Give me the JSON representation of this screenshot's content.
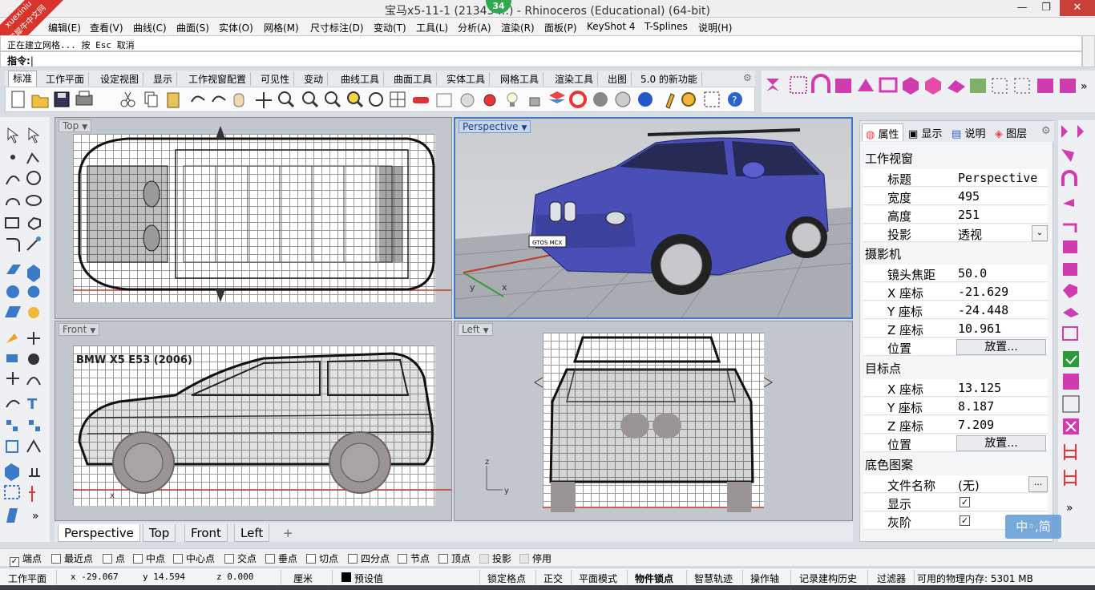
{
  "window": {
    "title": "宝马x5-11-1 (21343 …) - Rhinoceros (Educational) (64-bit)",
    "badge": "34",
    "minimize": "—",
    "maximize": "❐",
    "close": "✕"
  },
  "watermark": {
    "line1": "xuexiniu",
    "line2": "学犀牛中文网"
  },
  "menu": [
    "编辑(E)",
    "查看(V)",
    "曲线(C)",
    "曲面(S)",
    "实体(O)",
    "网格(M)",
    "尺寸标注(D)",
    "变动(T)",
    "工具(L)",
    "分析(A)",
    "渲染(R)",
    "面板(P)",
    "KeyShot 4",
    "T-Splines",
    "说明(H)"
  ],
  "command": {
    "history": "正在建立网格... 按 Esc 取消",
    "prompt": "指令:"
  },
  "toolbar_tabs": [
    "标准",
    "工作平面",
    "设定视图",
    "显示",
    "工作视窗配置",
    "可见性",
    "变动",
    "曲线工具",
    "曲面工具",
    "实体工具",
    "网格工具",
    "渲染工具",
    "出图",
    "5.0 的新功能"
  ],
  "active_toolbar_tab": "标准",
  "viewports": {
    "top": {
      "label": "Top"
    },
    "perspective": {
      "label": "Perspective",
      "plate": "GTOS MCX"
    },
    "front": {
      "label": "Front",
      "caption": "BMW X5 E53 (2006)"
    },
    "left": {
      "label": "Left"
    }
  },
  "viewport_tabs": [
    "Perspective",
    "Top",
    "Front",
    "Left"
  ],
  "viewport_tab_add": "+",
  "panel": {
    "tabs": [
      "属性",
      "显示",
      "说明",
      "图层"
    ],
    "sections": {
      "viewport": "工作视窗",
      "camera": "摄影机",
      "target": "目标点",
      "wallpaper": "底色图案"
    },
    "rows": {
      "title": {
        "k": "标题",
        "v": "Perspective"
      },
      "width": {
        "k": "宽度",
        "v": "495"
      },
      "height": {
        "k": "高度",
        "v": "251"
      },
      "projection": {
        "k": "投影",
        "v": "透视"
      },
      "lens": {
        "k": "镜头焦距",
        "v": "50.0"
      },
      "cam_x": {
        "k": "X 座标",
        "v": "-21.629"
      },
      "cam_y": {
        "k": "Y 座标",
        "v": "-24.448"
      },
      "cam_z": {
        "k": "Z 座标",
        "v": "10.961"
      },
      "cam_pos": {
        "k": "位置",
        "btn": "放置..."
      },
      "tgt_x": {
        "k": "X 座标",
        "v": "13.125"
      },
      "tgt_y": {
        "k": "Y 座标",
        "v": "8.187"
      },
      "tgt_z": {
        "k": "Z 座标",
        "v": "7.209"
      },
      "tgt_pos": {
        "k": "位置",
        "btn": "放置..."
      },
      "file": {
        "k": "文件名称",
        "v": "(无)",
        "btn": "..."
      },
      "show": {
        "k": "显示",
        "checked": true
      },
      "gray": {
        "k": "灰阶",
        "checked": true
      }
    }
  },
  "osnaps": [
    {
      "label": "端点",
      "checked": true
    },
    {
      "label": "最近点",
      "checked": false
    },
    {
      "label": "点",
      "checked": false
    },
    {
      "label": "中点",
      "checked": false
    },
    {
      "label": "中心点",
      "checked": false
    },
    {
      "label": "交点",
      "checked": false
    },
    {
      "label": "垂点",
      "checked": false
    },
    {
      "label": "切点",
      "checked": false
    },
    {
      "label": "四分点",
      "checked": false
    },
    {
      "label": "节点",
      "checked": false
    },
    {
      "label": "顶点",
      "checked": false
    },
    {
      "label": "投影",
      "checked": false
    },
    {
      "label": "停用",
      "checked": false
    }
  ],
  "status": {
    "cplane": "工作平面",
    "x": "x -29.067",
    "y": "y 14.594",
    "z": "z 0.000",
    "unit": "厘米",
    "layer": "预设值",
    "grid_snap": "锁定格点",
    "ortho": "正交",
    "planar": "平面模式",
    "osnap": "物件锁点",
    "smarttrack": "智慧轨迹",
    "gumball": "操作轴",
    "history": "记录建构历史",
    "filter": "过滤器",
    "memory": "可用的物理内存: 5301 MB"
  },
  "ime": "中◦,简",
  "colors": {
    "car_body": "#4a4fb8",
    "ground": "#a9adb3",
    "red_axis": "#c0392b",
    "green_axis": "#3a9a3a"
  }
}
